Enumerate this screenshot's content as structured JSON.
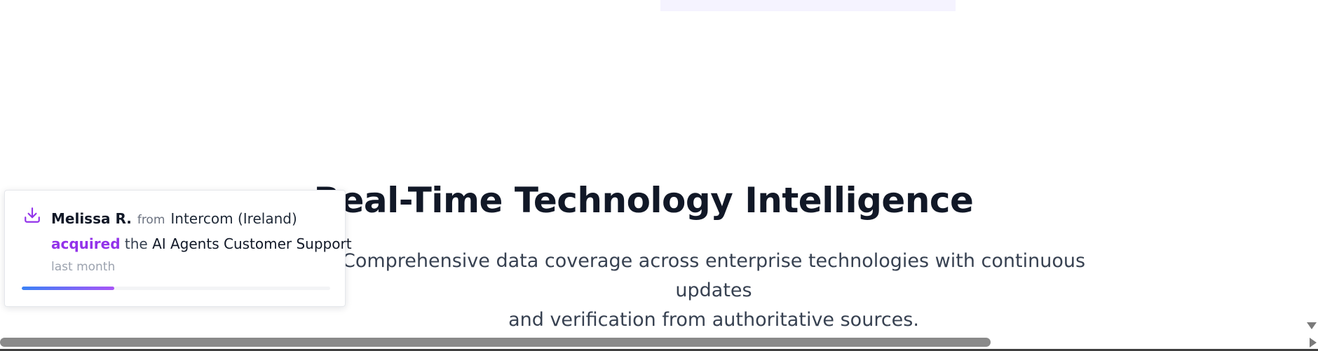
{
  "hero": {
    "title": "Real-Time Technology Intelligence",
    "subtitle_line1": "Comprehensive data coverage across enterprise technologies with continuous updates",
    "subtitle_line2": "and verification from authoritative sources."
  },
  "toast": {
    "icon": "download-icon",
    "name": "Melissa R.",
    "from_label": "from",
    "company": "Intercom (Ireland)",
    "action": "acquired",
    "article": "the",
    "product": "AI Agents Customer Support",
    "time": "last month",
    "progress": 0.3
  },
  "colors": {
    "accent": "#9333ea",
    "progress_start": "#3b82f6",
    "progress_end": "#a855f7",
    "title": "#111827"
  }
}
